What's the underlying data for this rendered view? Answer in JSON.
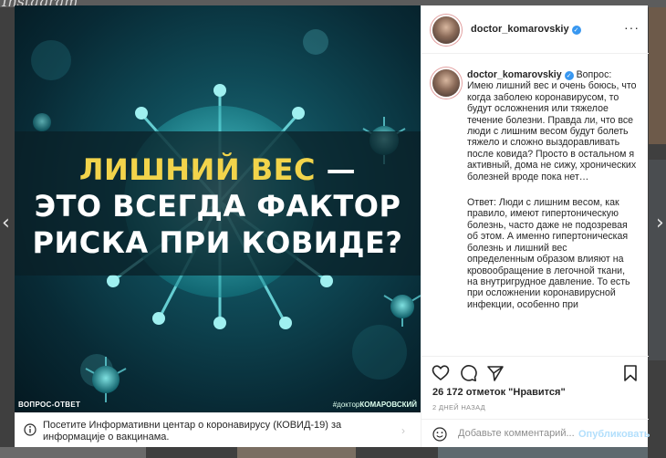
{
  "background": {
    "logo_text": "Instagram",
    "nav_prev_icon": "chevron-left-icon",
    "nav_next_icon": "chevron-right-icon"
  },
  "media": {
    "headline_line1_yellow": "ЛИШНИЙ ВЕС",
    "headline_line1_dash": " —",
    "headline_line2": "ЭТО ВСЕГДА ФАКТОР",
    "headline_line3": "РИСКА ПРИ КОВИДЕ?",
    "tag_left": "ВОПРОС-ОТВЕТ",
    "tag_right_prefix": "#доктор",
    "tag_right_name": "КОМАРОВСКИЙ"
  },
  "info_bar": {
    "text": "Посетите Информативни центар о коронавирусу (КОВИД-19) за информације о вакцинама."
  },
  "header": {
    "username": "doctor_komarovskiy",
    "more_icon": "more-horizontal-icon"
  },
  "caption": {
    "username": "doctor_komarovskiy",
    "question": "Вопрос: Имею лишний вес и очень боюсь, что когда заболею коронавирусом, то будут осложнения или тяжелое течение болезни. Правда ли, что все люди с лишним весом будут болеть тяжело и сложно выздоравливать после ковида? Просто в остальном я активный, дома не сижу, хронических болезней вроде пока нет…",
    "answer": "Ответ: Люди с лишним весом, как правило, имеют гипертоническую болезнь, часто даже не подозревая об этом. А именно гипертоническая болезнь и лишний вес определенным образом влияют на кровообращение в легочной ткани, на внутригрудное давление. То есть при осложнении коронавирусной инфекции, особенно при"
  },
  "actions": {
    "likes_text": "26 172 отметок \"Нравится\"",
    "time_ago": "2 ДНЕЙ НАЗАД",
    "comment_placeholder": "Добавьте комментарий...",
    "post_label": "Опубликовать"
  },
  "colors": {
    "headline_yellow": "#f2d44b",
    "verified_blue": "#3897f0",
    "post_disabled": "#b2dffc"
  }
}
